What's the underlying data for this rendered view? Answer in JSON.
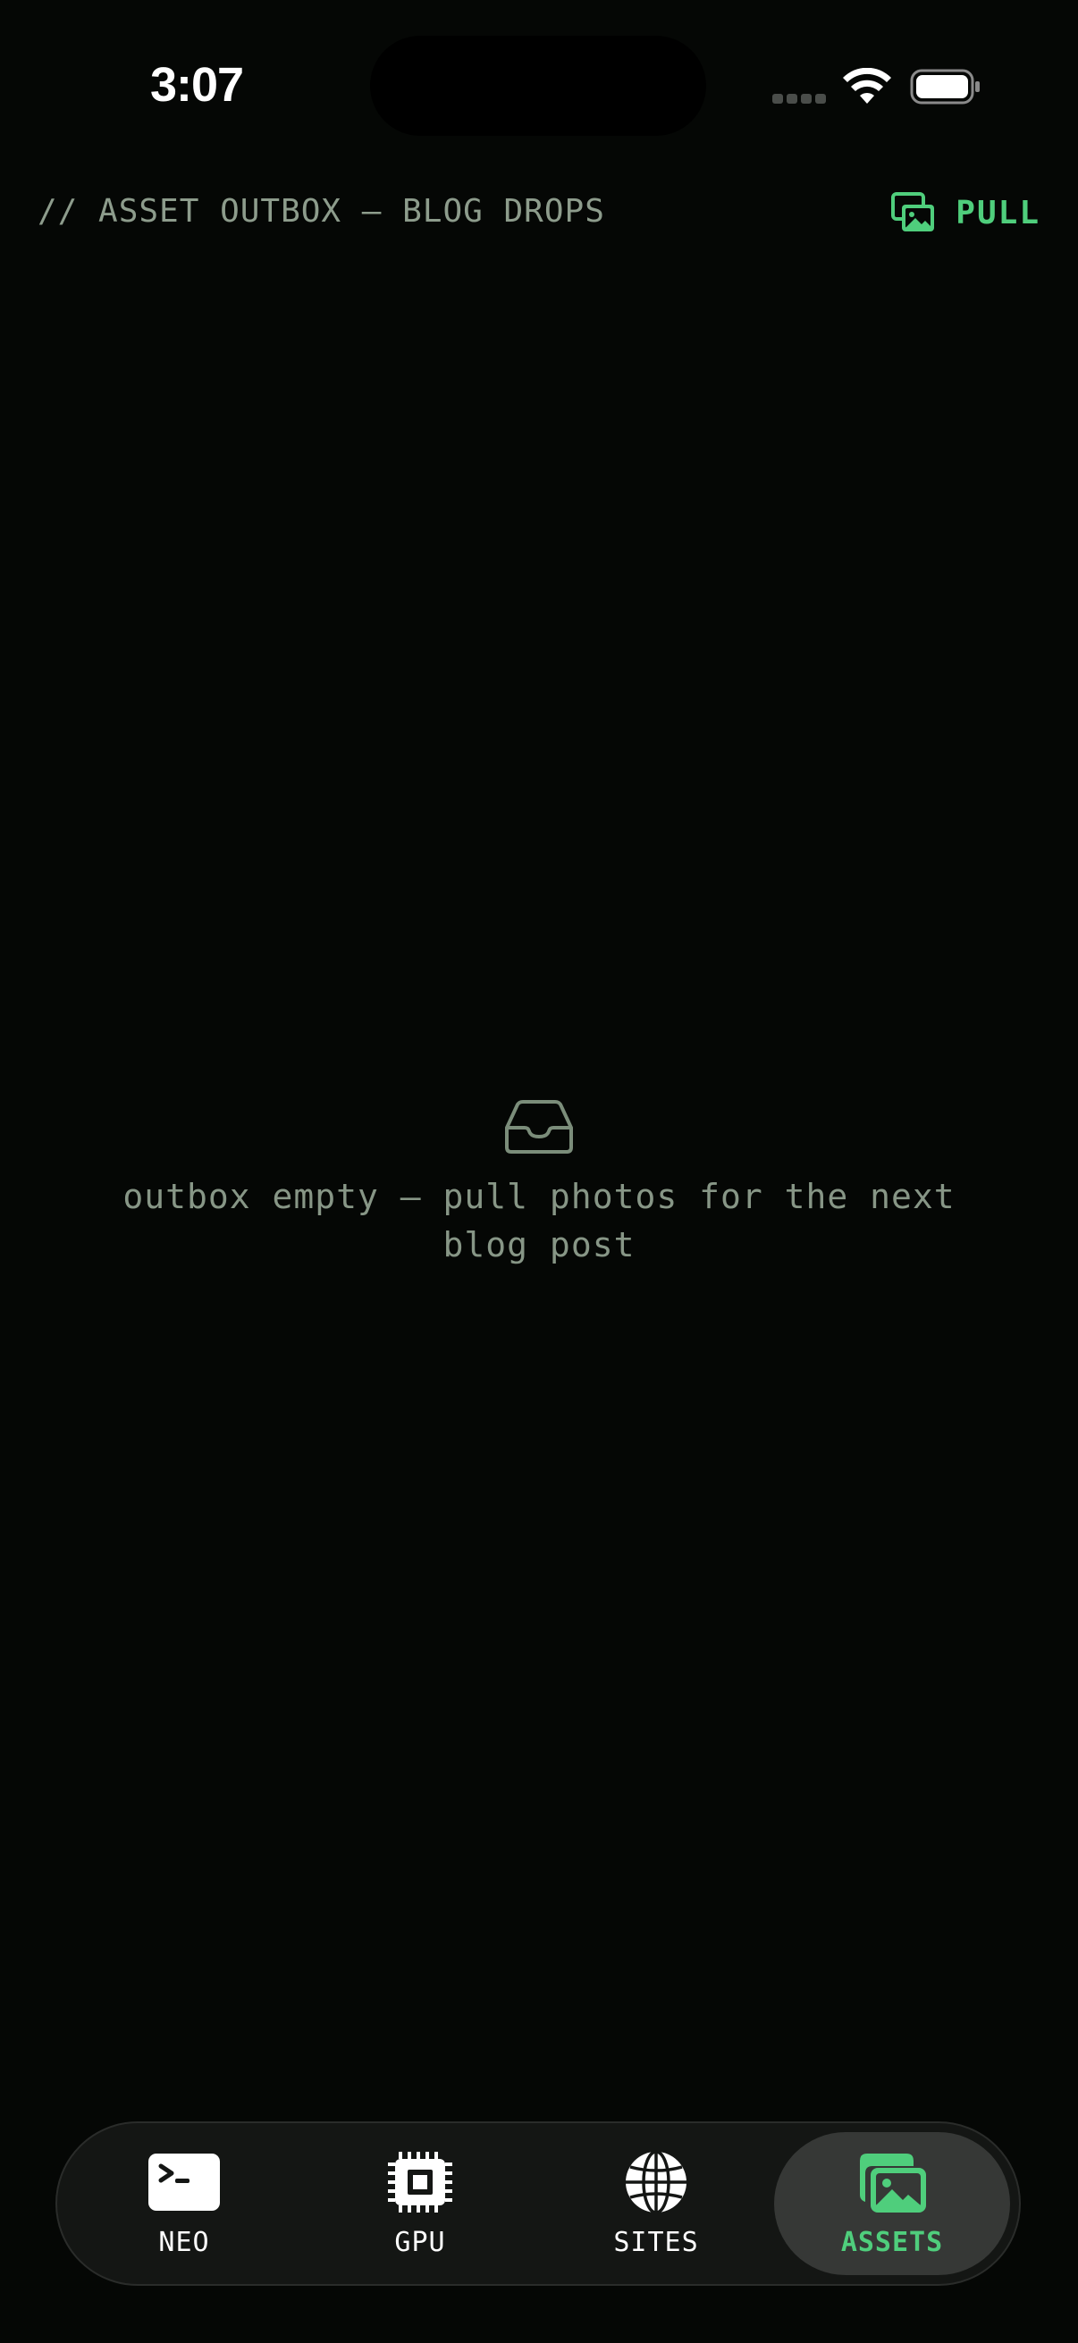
{
  "status_bar": {
    "time": "3:07"
  },
  "header": {
    "title": "// ASSET OUTBOX — BLOG DROPS",
    "pull_label": "PULL",
    "pull_icon": "photo-stack-icon"
  },
  "empty_state": {
    "icon": "inbox-icon",
    "message": "outbox empty — pull photos for the next blog post"
  },
  "tab_bar": {
    "tabs": [
      {
        "label": "NEO",
        "icon": "terminal-icon",
        "active": false
      },
      {
        "label": "GPU",
        "icon": "cpu-chip-icon",
        "active": false
      },
      {
        "label": "SITES",
        "icon": "globe-icon",
        "active": false
      },
      {
        "label": "ASSETS",
        "icon": "photos-icon",
        "active": true
      }
    ]
  },
  "colors": {
    "background": "#050705",
    "accent": "#4fce7c",
    "muted_text": "#8d9c8c",
    "tab_bar_bg": "#141614",
    "active_tab_bg": "#363836"
  }
}
